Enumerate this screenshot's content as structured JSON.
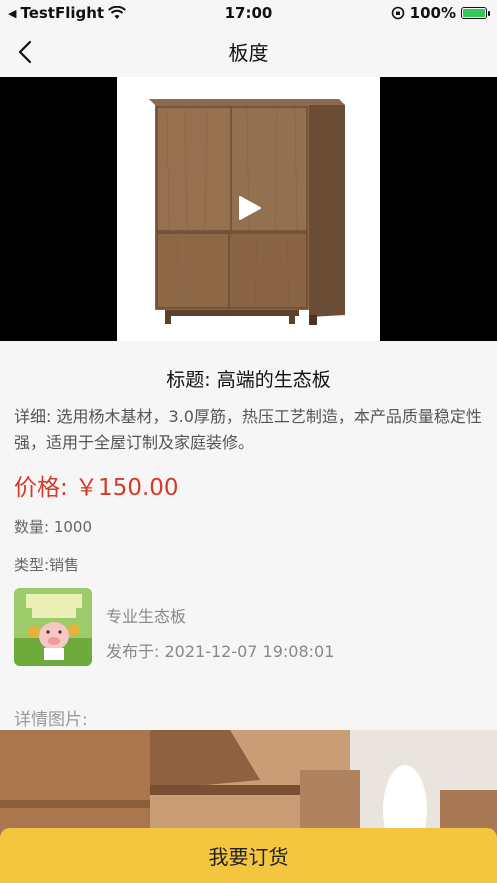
{
  "status_bar": {
    "carrier": "TestFlight",
    "time": "17:00",
    "battery": "100%"
  },
  "nav": {
    "title": "板度"
  },
  "product": {
    "title": "标题: 高端的生态板",
    "detail": "详细: 选用杨木基材，3.0厚筋，热压工艺制造，本产品质量稳定性强，适用于全屋订制及家庭装修。",
    "price": "价格: ￥150.00",
    "quantity": "数量: 1000",
    "type": "类型:销售"
  },
  "seller": {
    "name": "专业生态板",
    "posted": "发布于: 2021-12-07 19:08:01"
  },
  "details_label": "详情图片:",
  "order_button": "我要订货",
  "colors": {
    "price": "#d23a2a",
    "button": "#f4c53f"
  }
}
